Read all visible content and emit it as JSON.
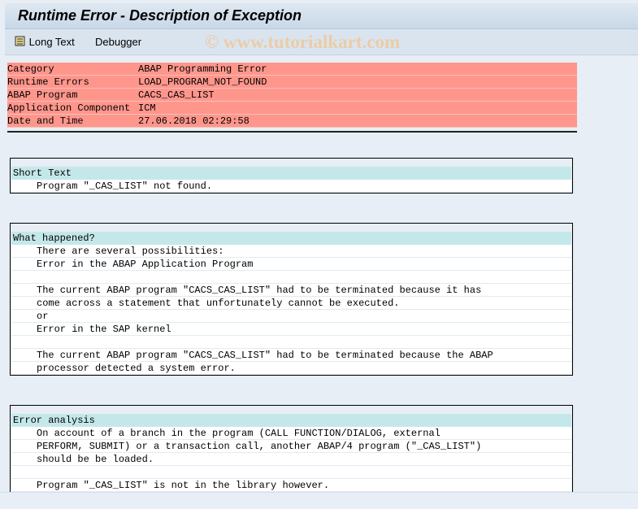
{
  "window": {
    "title": "Runtime Error - Description of Exception"
  },
  "toolbar": {
    "long_text": "Long Text",
    "debugger": "Debugger",
    "watermark": "© www.tutorialkart.com",
    "long_text_icon": "scroll-icon"
  },
  "header": [
    {
      "key": "Category",
      "value": "ABAP Programming Error"
    },
    {
      "key": "Runtime Errors",
      "value": "LOAD_PROGRAM_NOT_FOUND"
    },
    {
      "key": "ABAP Program",
      "value": "CACS_CAS_LIST"
    },
    {
      "key": "Application Component",
      "value": "ICM"
    },
    {
      "key": "Date and Time",
      "value": "27.06.2018 02:29:58"
    }
  ],
  "sections": [
    {
      "title": "Short Text",
      "lines": [
        "Program \"_CAS_LIST\" not found."
      ]
    },
    {
      "title": "What happened?",
      "lines": [
        "There are several possibilities:",
        "Error in the ABAP Application Program",
        "",
        "The current ABAP program \"CACS_CAS_LIST\" had to be terminated because it has",
        "come across a statement that unfortunately cannot be executed.",
        "or",
        "Error in the SAP kernel",
        "",
        "The current ABAP program \"CACS_CAS_LIST\" had to be terminated because the ABAP",
        "processor detected a system error."
      ]
    },
    {
      "title": "Error analysis",
      "lines": [
        "On account of a branch in the program (CALL FUNCTION/DIALOG, external",
        "PERFORM, SUBMIT) or a transaction call, another ABAP/4 program (\"_CAS_LIST\")",
        "should be be loaded.",
        "",
        "Program \"_CAS_LIST\" is not in the library however.",
        ""
      ]
    }
  ],
  "colors": {
    "header_row": "#ff968c",
    "section_header": "#c4e8ea",
    "background": "#e8eef5"
  }
}
